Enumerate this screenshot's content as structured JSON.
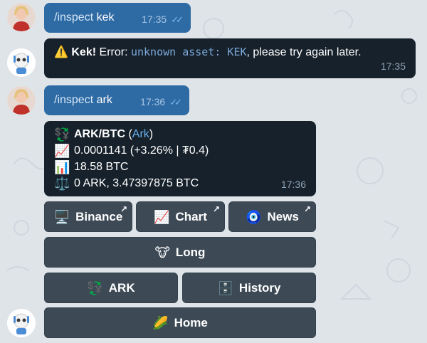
{
  "messages": [
    {
      "type": "out",
      "text_cmd": "/inspect",
      "text_arg": "kek",
      "time": "17:35"
    },
    {
      "type": "in",
      "prefix_icon": "⚠️",
      "bold": "Kek!",
      "pre": "Error:",
      "code": "unknown asset: KEK",
      "post": ", please try again later.",
      "time": "17:35"
    },
    {
      "type": "out",
      "text_cmd": "/inspect",
      "text_arg": "ark",
      "time": "17:36"
    },
    {
      "type": "in",
      "title_bold": "ARK/BTC",
      "title_link": "Ark",
      "lines": [
        {
          "icon": "📈",
          "text": "0.0001141 (+3.26% | ₮0.4)"
        },
        {
          "icon": "📊",
          "text": "18.58 BTC"
        },
        {
          "icon": "⚖️",
          "text": "0 ARK, 3.47397875 BTC"
        }
      ],
      "time": "17:36"
    }
  ],
  "keyboard": {
    "row1": [
      {
        "icon": "🖥️",
        "label": "Binance",
        "arrow": "↗"
      },
      {
        "icon": "📈",
        "label": "Chart",
        "arrow": "↗"
      },
      {
        "icon": "🧿",
        "label": "News",
        "arrow": "↗"
      }
    ],
    "row2": [
      {
        "icon": "🐮",
        "label": "Long"
      }
    ],
    "row3": [
      {
        "icon": "💱",
        "label": "ARK"
      },
      {
        "icon": "🗄️",
        "label": "History"
      }
    ],
    "row4": [
      {
        "icon": "🌽",
        "label": "Home"
      }
    ]
  },
  "icons": {
    "user_avatar": "user-avatar",
    "bot_avatar": "bot-avatar",
    "read_checks": "double-check-icon",
    "currency_exchange": "currency-exchange-icon"
  },
  "colors": {
    "background": "#dfe4e9",
    "outgoing_bubble": "#2e6aa3",
    "incoming_bubble": "#17212b",
    "keyboard_button": "#3d4a56",
    "link": "#6ab2f2"
  }
}
